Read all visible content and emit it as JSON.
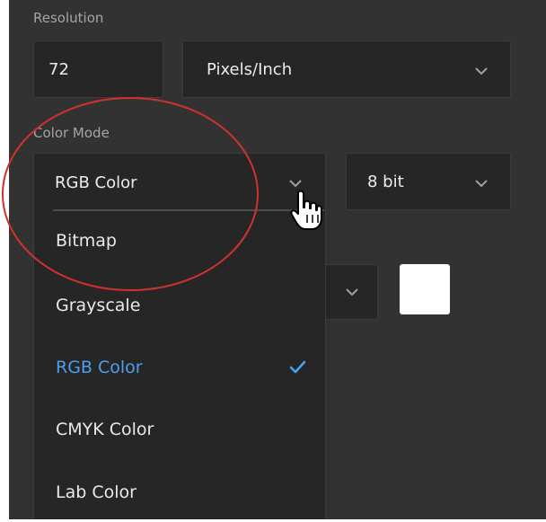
{
  "resolution": {
    "label": "Resolution",
    "value": "72",
    "unit": "Pixels/Inch"
  },
  "color_mode": {
    "label": "Color Mode",
    "selected": "RGB Color",
    "bit_depth": "8 bit",
    "options": [
      {
        "label": "Bitmap",
        "selected": false
      },
      {
        "label": "Grayscale",
        "selected": false
      },
      {
        "label": "RGB Color",
        "selected": true
      },
      {
        "label": "CMYK Color",
        "selected": false
      },
      {
        "label": "Lab Color",
        "selected": false
      }
    ]
  },
  "icons": {
    "chevron": "chevron-down-icon",
    "check": "checkmark-icon",
    "cursor": "hand-pointer-icon"
  },
  "colors": {
    "panel_bg": "#323232",
    "field_bg": "#262626",
    "selected_text": "#4a9ff1",
    "annotation": "#d0312d",
    "swatch": "#ffffff"
  }
}
